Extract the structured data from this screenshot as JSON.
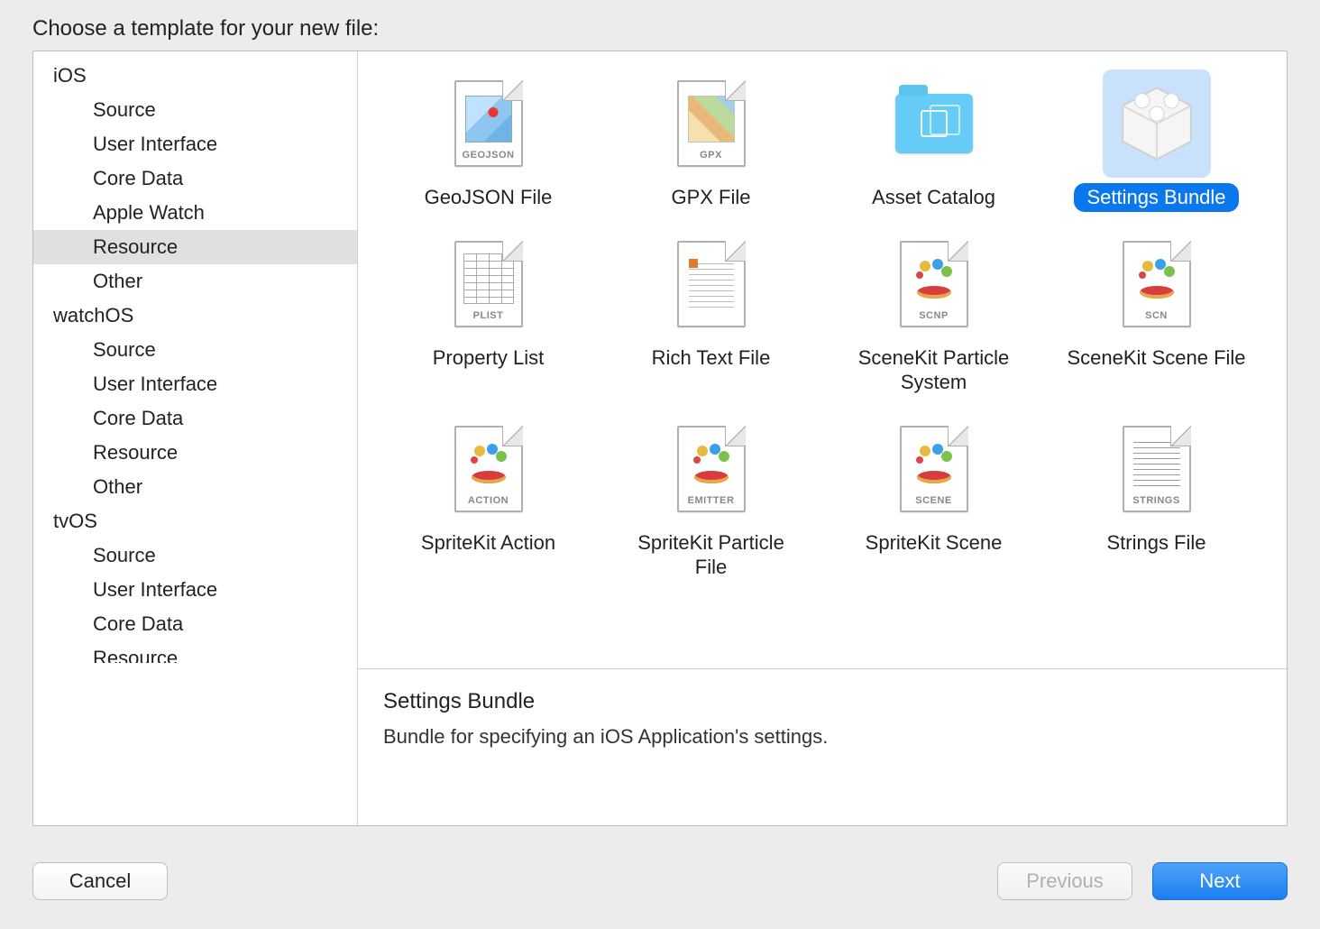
{
  "heading": "Choose a template for your new file:",
  "sidebar": {
    "platforms": [
      {
        "name": "iOS",
        "categories": [
          "Source",
          "User Interface",
          "Core Data",
          "Apple Watch",
          "Resource",
          "Other"
        ],
        "selected_category_index": 4
      },
      {
        "name": "watchOS",
        "categories": [
          "Source",
          "User Interface",
          "Core Data",
          "Resource",
          "Other"
        ],
        "selected_category_index": -1
      },
      {
        "name": "tvOS",
        "categories": [
          "Source",
          "User Interface",
          "Core Data",
          "Resource"
        ],
        "selected_category_index": -1
      }
    ]
  },
  "templates": [
    {
      "label": "GeoJSON File",
      "icon": "geojson-file-icon",
      "tag": "GEOJSON",
      "selected": false
    },
    {
      "label": "GPX File",
      "icon": "gpx-file-icon",
      "tag": "GPX",
      "selected": false
    },
    {
      "label": "Asset Catalog",
      "icon": "asset-catalog-folder-icon",
      "tag": "",
      "selected": false
    },
    {
      "label": "Settings Bundle",
      "icon": "settings-bundle-icon",
      "tag": "",
      "selected": true
    },
    {
      "label": "Property List",
      "icon": "plist-file-icon",
      "tag": "PLIST",
      "selected": false
    },
    {
      "label": "Rich Text File",
      "icon": "rtf-file-icon",
      "tag": "",
      "selected": false
    },
    {
      "label": "SceneKit Particle System",
      "icon": "scnp-file-icon",
      "tag": "SCNP",
      "selected": false
    },
    {
      "label": "SceneKit Scene File",
      "icon": "scn-file-icon",
      "tag": "SCN",
      "selected": false
    },
    {
      "label": "SpriteKit Action",
      "icon": "sk-action-file-icon",
      "tag": "ACTION",
      "selected": false
    },
    {
      "label": "SpriteKit Particle File",
      "icon": "sk-emitter-file-icon",
      "tag": "EMITTER",
      "selected": false
    },
    {
      "label": "SpriteKit Scene",
      "icon": "sk-scene-file-icon",
      "tag": "SCENE",
      "selected": false
    },
    {
      "label": "Strings File",
      "icon": "strings-file-icon",
      "tag": "STRINGS",
      "selected": false
    }
  ],
  "description": {
    "title": "Settings Bundle",
    "text": "Bundle for specifying an iOS Application's settings."
  },
  "buttons": {
    "cancel": "Cancel",
    "previous": "Previous",
    "next": "Next",
    "previous_enabled": false
  }
}
